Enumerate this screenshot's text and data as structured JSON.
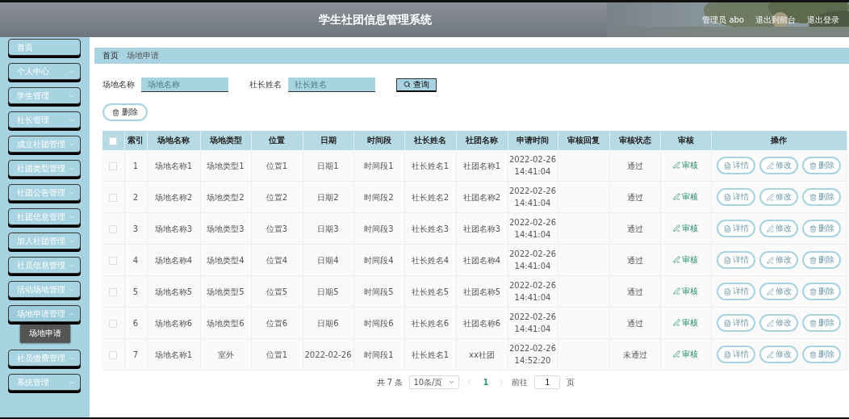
{
  "header": {
    "title": "学生社团信息管理系统",
    "user": "管理员 abo",
    "links": [
      "退出到前台",
      "退出登录"
    ]
  },
  "sidebar": {
    "items": [
      {
        "label": "首页",
        "expanded": false
      },
      {
        "label": "个人中心",
        "expanded": false
      },
      {
        "label": "学生管理",
        "expanded": false
      },
      {
        "label": "社长管理",
        "expanded": false
      },
      {
        "label": "成立社团管理",
        "expanded": false
      },
      {
        "label": "社团类型管理",
        "expanded": false
      },
      {
        "label": "社团公告管理",
        "expanded": false
      },
      {
        "label": "社团信息管理",
        "expanded": false
      },
      {
        "label": "加入社团管理",
        "expanded": false
      },
      {
        "label": "社员信息管理",
        "expanded": false
      },
      {
        "label": "活动场地管理",
        "expanded": false
      },
      {
        "label": "场地申请管理",
        "expanded": true,
        "children": [
          {
            "label": "场地申请",
            "selected": true
          }
        ]
      },
      {
        "label": "社员缴费管理",
        "expanded": false
      },
      {
        "label": "系统管理",
        "expanded": false
      }
    ]
  },
  "breadcrumb": [
    "首页",
    "场地申请"
  ],
  "search": {
    "fields": [
      {
        "label": "场地名称",
        "placeholder": "场地名称"
      },
      {
        "label": "社长姓名",
        "placeholder": "社长姓名"
      }
    ],
    "button": "查询"
  },
  "delete_button": "删除",
  "table": {
    "select_all": {
      "checked": false
    },
    "columns": [
      "索引",
      "场地名称",
      "场地类型",
      "位置",
      "日期",
      "时间段",
      "社长姓名",
      "社团名称",
      "申请时间",
      "审核回复",
      "审核状态",
      "审核",
      "操作"
    ],
    "rows": [
      {
        "checked": false,
        "cells": [
          "1",
          "场地名称1",
          "场地类型1",
          "位置1",
          "日期1",
          "时间段1",
          "社长姓名1",
          "社团名称1",
          "2022-02-26 14:41:04",
          "",
          "通过"
        ],
        "review": "审核",
        "actions": [
          "详情",
          "修改",
          "删除"
        ]
      },
      {
        "checked": false,
        "cells": [
          "2",
          "场地名称2",
          "场地类型2",
          "位置2",
          "日期2",
          "时间段2",
          "社长姓名2",
          "社团名称2",
          "2022-02-26 14:41:04",
          "",
          "通过"
        ],
        "review": "审核",
        "actions": [
          "详情",
          "修改",
          "删除"
        ]
      },
      {
        "checked": false,
        "cells": [
          "3",
          "场地名称3",
          "场地类型3",
          "位置3",
          "日期3",
          "时间段3",
          "社长姓名3",
          "社团名称3",
          "2022-02-26 14:41:04",
          "",
          "通过"
        ],
        "review": "审核",
        "actions": [
          "详情",
          "修改",
          "删除"
        ]
      },
      {
        "checked": false,
        "cells": [
          "4",
          "场地名称4",
          "场地类型4",
          "位置4",
          "日期4",
          "时间段4",
          "社长姓名4",
          "社团名称4",
          "2022-02-26 14:41:04",
          "",
          "通过"
        ],
        "review": "审核",
        "actions": [
          "详情",
          "修改",
          "删除"
        ]
      },
      {
        "checked": false,
        "cells": [
          "5",
          "场地名称5",
          "场地类型5",
          "位置5",
          "日期5",
          "时间段5",
          "社长姓名5",
          "社团名称5",
          "2022-02-26 14:41:04",
          "",
          "通过"
        ],
        "review": "审核",
        "actions": [
          "详情",
          "修改",
          "删除"
        ]
      },
      {
        "checked": false,
        "cells": [
          "6",
          "场地名称6",
          "场地类型6",
          "位置6",
          "日期6",
          "时间段6",
          "社长姓名6",
          "社团名称6",
          "2022-02-26 14:41:04",
          "",
          "通过"
        ],
        "review": "审核",
        "actions": [
          "详情",
          "修改",
          "删除"
        ]
      },
      {
        "checked": false,
        "cells": [
          "7",
          "场地名称1",
          "室外",
          "位置1",
          "2022-02-26",
          "时间段1",
          "社长姓名1",
          "xx社团",
          "2022-02-26 14:52:20",
          "",
          "未通过"
        ],
        "review": "审核",
        "actions": [
          "详情",
          "修改",
          "删除"
        ]
      }
    ]
  },
  "pagination": {
    "total": "共 7 条",
    "page_size": "10条/页",
    "pages": [
      {
        "label": "1",
        "selected": true
      }
    ],
    "goto_label": "前往",
    "goto_value": "1",
    "goto_suffix": "页"
  }
}
